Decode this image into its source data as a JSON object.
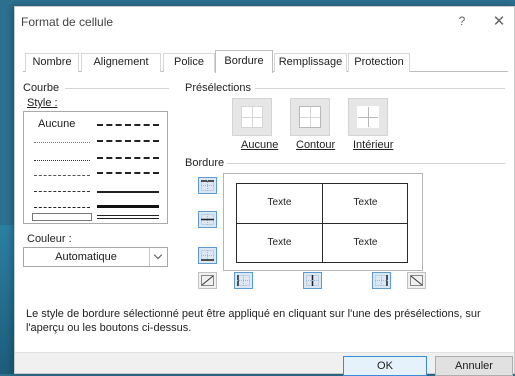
{
  "dialog": {
    "title": "Format de cellule",
    "help": "?",
    "close": "✕"
  },
  "tabs": [
    "Nombre",
    "Alignement",
    "Police",
    "Bordure",
    "Remplissage",
    "Protection"
  ],
  "active_tab": "Bordure",
  "line_section": {
    "title": "Courbe",
    "style_label": "Style :",
    "style_none": "Aucune",
    "color_label": "Couleur :",
    "color_value": "Automatique"
  },
  "presets": {
    "title": "Présélections",
    "items": [
      "Aucune",
      "Contour",
      "Intérieur"
    ]
  },
  "border_section": {
    "title": "Bordure"
  },
  "preview": {
    "cells": [
      "Texte",
      "Texte",
      "Texte",
      "Texte"
    ]
  },
  "description": "Le style de bordure sélectionné peut être appliqué en cliquant sur l'une des présélections, sur l'aperçu ou les boutons ci-dessus.",
  "buttons": {
    "ok": "OK",
    "cancel": "Annuler"
  },
  "colors": {
    "accent": "#5d9bd1",
    "primary_button_border": "#3c8bd9",
    "background": "#2d6f8e"
  }
}
